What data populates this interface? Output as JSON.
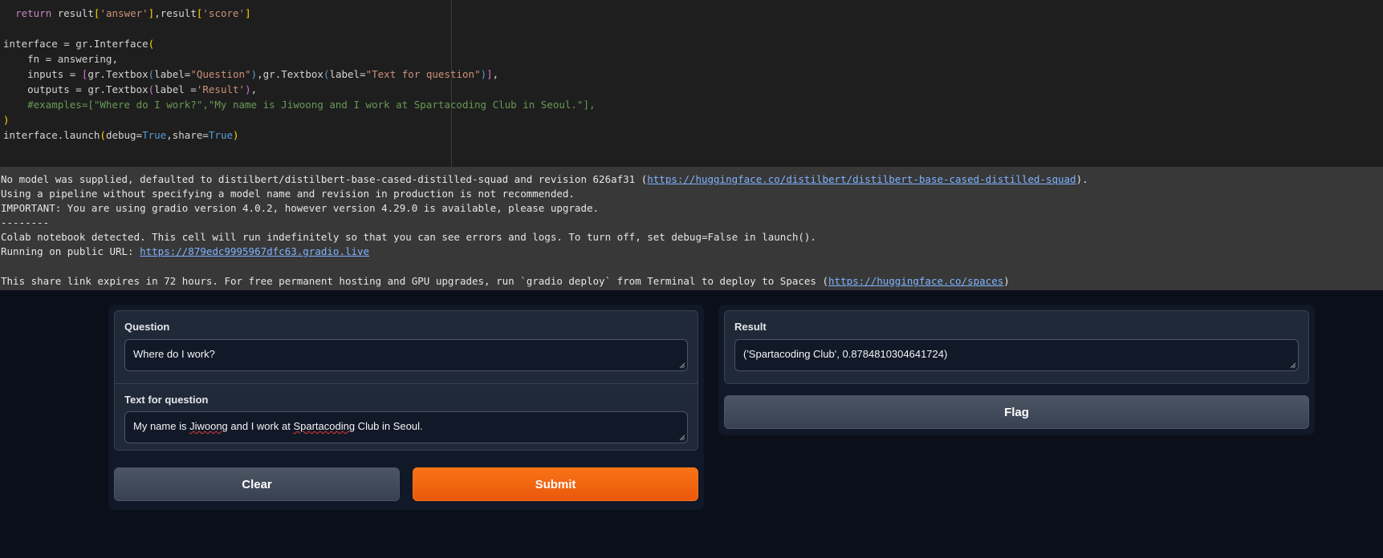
{
  "code": {
    "lines": [
      "  return result['answer'],result['score']",
      "",
      "interface = gr.Interface(",
      "    fn = answering,",
      "    inputs = [gr.Textbox(label=\"Question\"),gr.Textbox(label=\"Text for question\")],",
      "    outputs = gr.Textbox(label ='Result'),",
      "    #examples=[\"Where do I work?\",\"My name is Jiwoong and I work at Spartacoding Club in Seoul.\"],",
      ")",
      "interface.launch(debug=True,share=True)"
    ]
  },
  "output": {
    "line1_prefix": "No model was supplied, defaulted to distilbert/distilbert-base-cased-distilled-squad and revision 626af31 (",
    "line1_link": "https://huggingface.co/distilbert/distilbert-base-cased-distilled-squad",
    "line1_suffix": ").",
    "line2": "Using a pipeline without specifying a model name and revision in production is not recommended.",
    "line3": "IMPORTANT: You are using gradio version 4.0.2, however version 4.29.0 is available, please upgrade.",
    "line4": "--------",
    "line5": "Colab notebook detected. This cell will run indefinitely so that you can see errors and logs. To turn off, set debug=False in launch().",
    "line6_prefix": "Running on public URL: ",
    "line6_link": "https://879edc9995967dfc63.gradio.live",
    "line8_prefix": "This share link expires in 72 hours. For free permanent hosting and GPU upgrades, run `gradio deploy` from Terminal to deploy to Spaces (",
    "line8_link": "https://huggingface.co/spaces",
    "line8_suffix": ")"
  },
  "gradio": {
    "question_label": "Question",
    "question_value": "Where do I work?",
    "context_label": "Text for question",
    "context_value_pre": "My name is ",
    "context_value_w1": "Jiwoong",
    "context_value_mid": " and I work at ",
    "context_value_w2": "Spartacoding",
    "context_value_post": " Club in Seoul.",
    "clear_label": "Clear",
    "submit_label": "Submit",
    "result_label": "Result",
    "result_value": "('Spartacoding Club', 0.8784810304641724)",
    "flag_label": "Flag"
  },
  "colors": {
    "primary": "#f97316",
    "background": "#0b0f19",
    "output_background": "#383838",
    "code_background": "#1e1e1e"
  }
}
